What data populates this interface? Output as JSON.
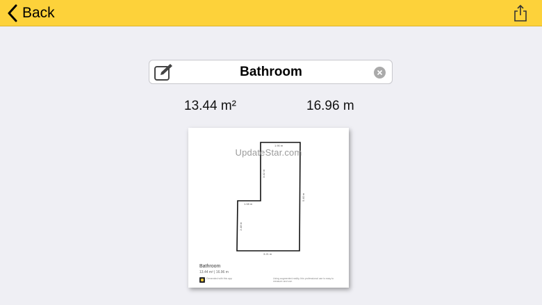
{
  "nav": {
    "back_label": "Back"
  },
  "room": {
    "name": "Bathroom",
    "area": "13.44 m²",
    "perimeter": "16.96 m"
  },
  "plan": {
    "watermark": "UpdateStar.com",
    "title": "Bathroom",
    "subtitle": "13.44 m² | 16.96 m",
    "dims": {
      "top": "1.90 m",
      "upper_left": "3.42 m",
      "right": "5.40 m",
      "step": "1.08 m",
      "lower_left": "2.48 m",
      "bottom": "3.21 m"
    },
    "footer_left": "Generated with this app",
    "footer_right": "Using augmented reality, this professional use is easy to measure and use."
  },
  "colors": {
    "toolbar": "#fdd23a",
    "background": "#efeff4"
  }
}
